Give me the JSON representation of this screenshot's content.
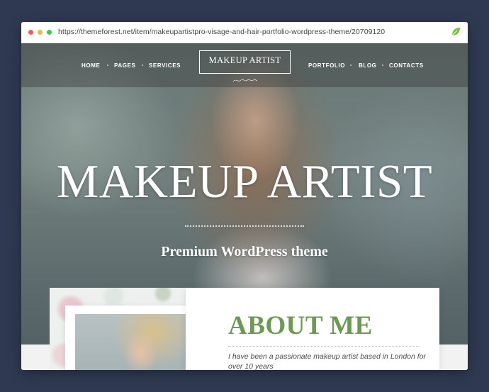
{
  "browser": {
    "url": "https://themeforest.net/item/makeupartistpro-visage-and-hair-portfolio-wordpress-theme/20709120",
    "extension_icon": "leaf-icon"
  },
  "nav": {
    "left_items": [
      "HOME",
      "PAGES",
      "SERVICES"
    ],
    "right_items": [
      "PORTFOLIO",
      "BLOG",
      "CONTACTS"
    ],
    "logo": "MAKEUP ARTIST"
  },
  "hero": {
    "title": "MAKEUP ARTIST",
    "subtitle": "Premium WordPress theme"
  },
  "about": {
    "heading": "ABOUT ME",
    "text": "I have been a passionate makeup artist based in London for over 10 years"
  },
  "colors": {
    "page_bg": "#2f3a52",
    "accent_green": "#6b9a52"
  }
}
